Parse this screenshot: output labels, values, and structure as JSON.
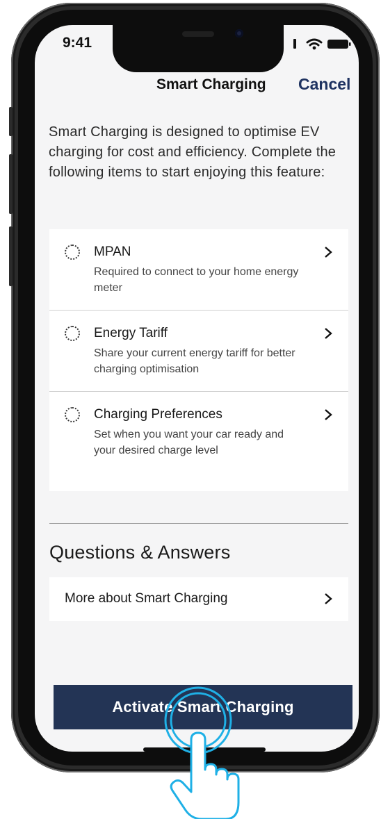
{
  "status_bar": {
    "time": "9:41"
  },
  "nav": {
    "title": "Smart Charging",
    "cancel_label": "Cancel"
  },
  "intro": "Smart Charging is designed to optimise EV charging for cost and efficiency. Complete the following items to start enjoying this feature:",
  "setup_items": [
    {
      "title": "MPAN",
      "description": "Required to connect to your home energy meter",
      "icon": "dotted-circle-icon"
    },
    {
      "title": "Energy Tariff",
      "description": "Share your current energy tariff for better charging optimisation",
      "icon": "dotted-circle-icon"
    },
    {
      "title": "Charging Preferences",
      "description": "Set when you want your car ready and your desired charge level",
      "icon": "dotted-circle-icon"
    }
  ],
  "qa": {
    "heading": "Questions & Answers",
    "items": [
      {
        "label": "More about Smart Charging"
      }
    ]
  },
  "cta": {
    "label": "Activate Smart Charging"
  },
  "colors": {
    "accent": "#1e3260",
    "button": "#233455",
    "touch": "#1fb0e6",
    "background": "#f5f5f6"
  }
}
